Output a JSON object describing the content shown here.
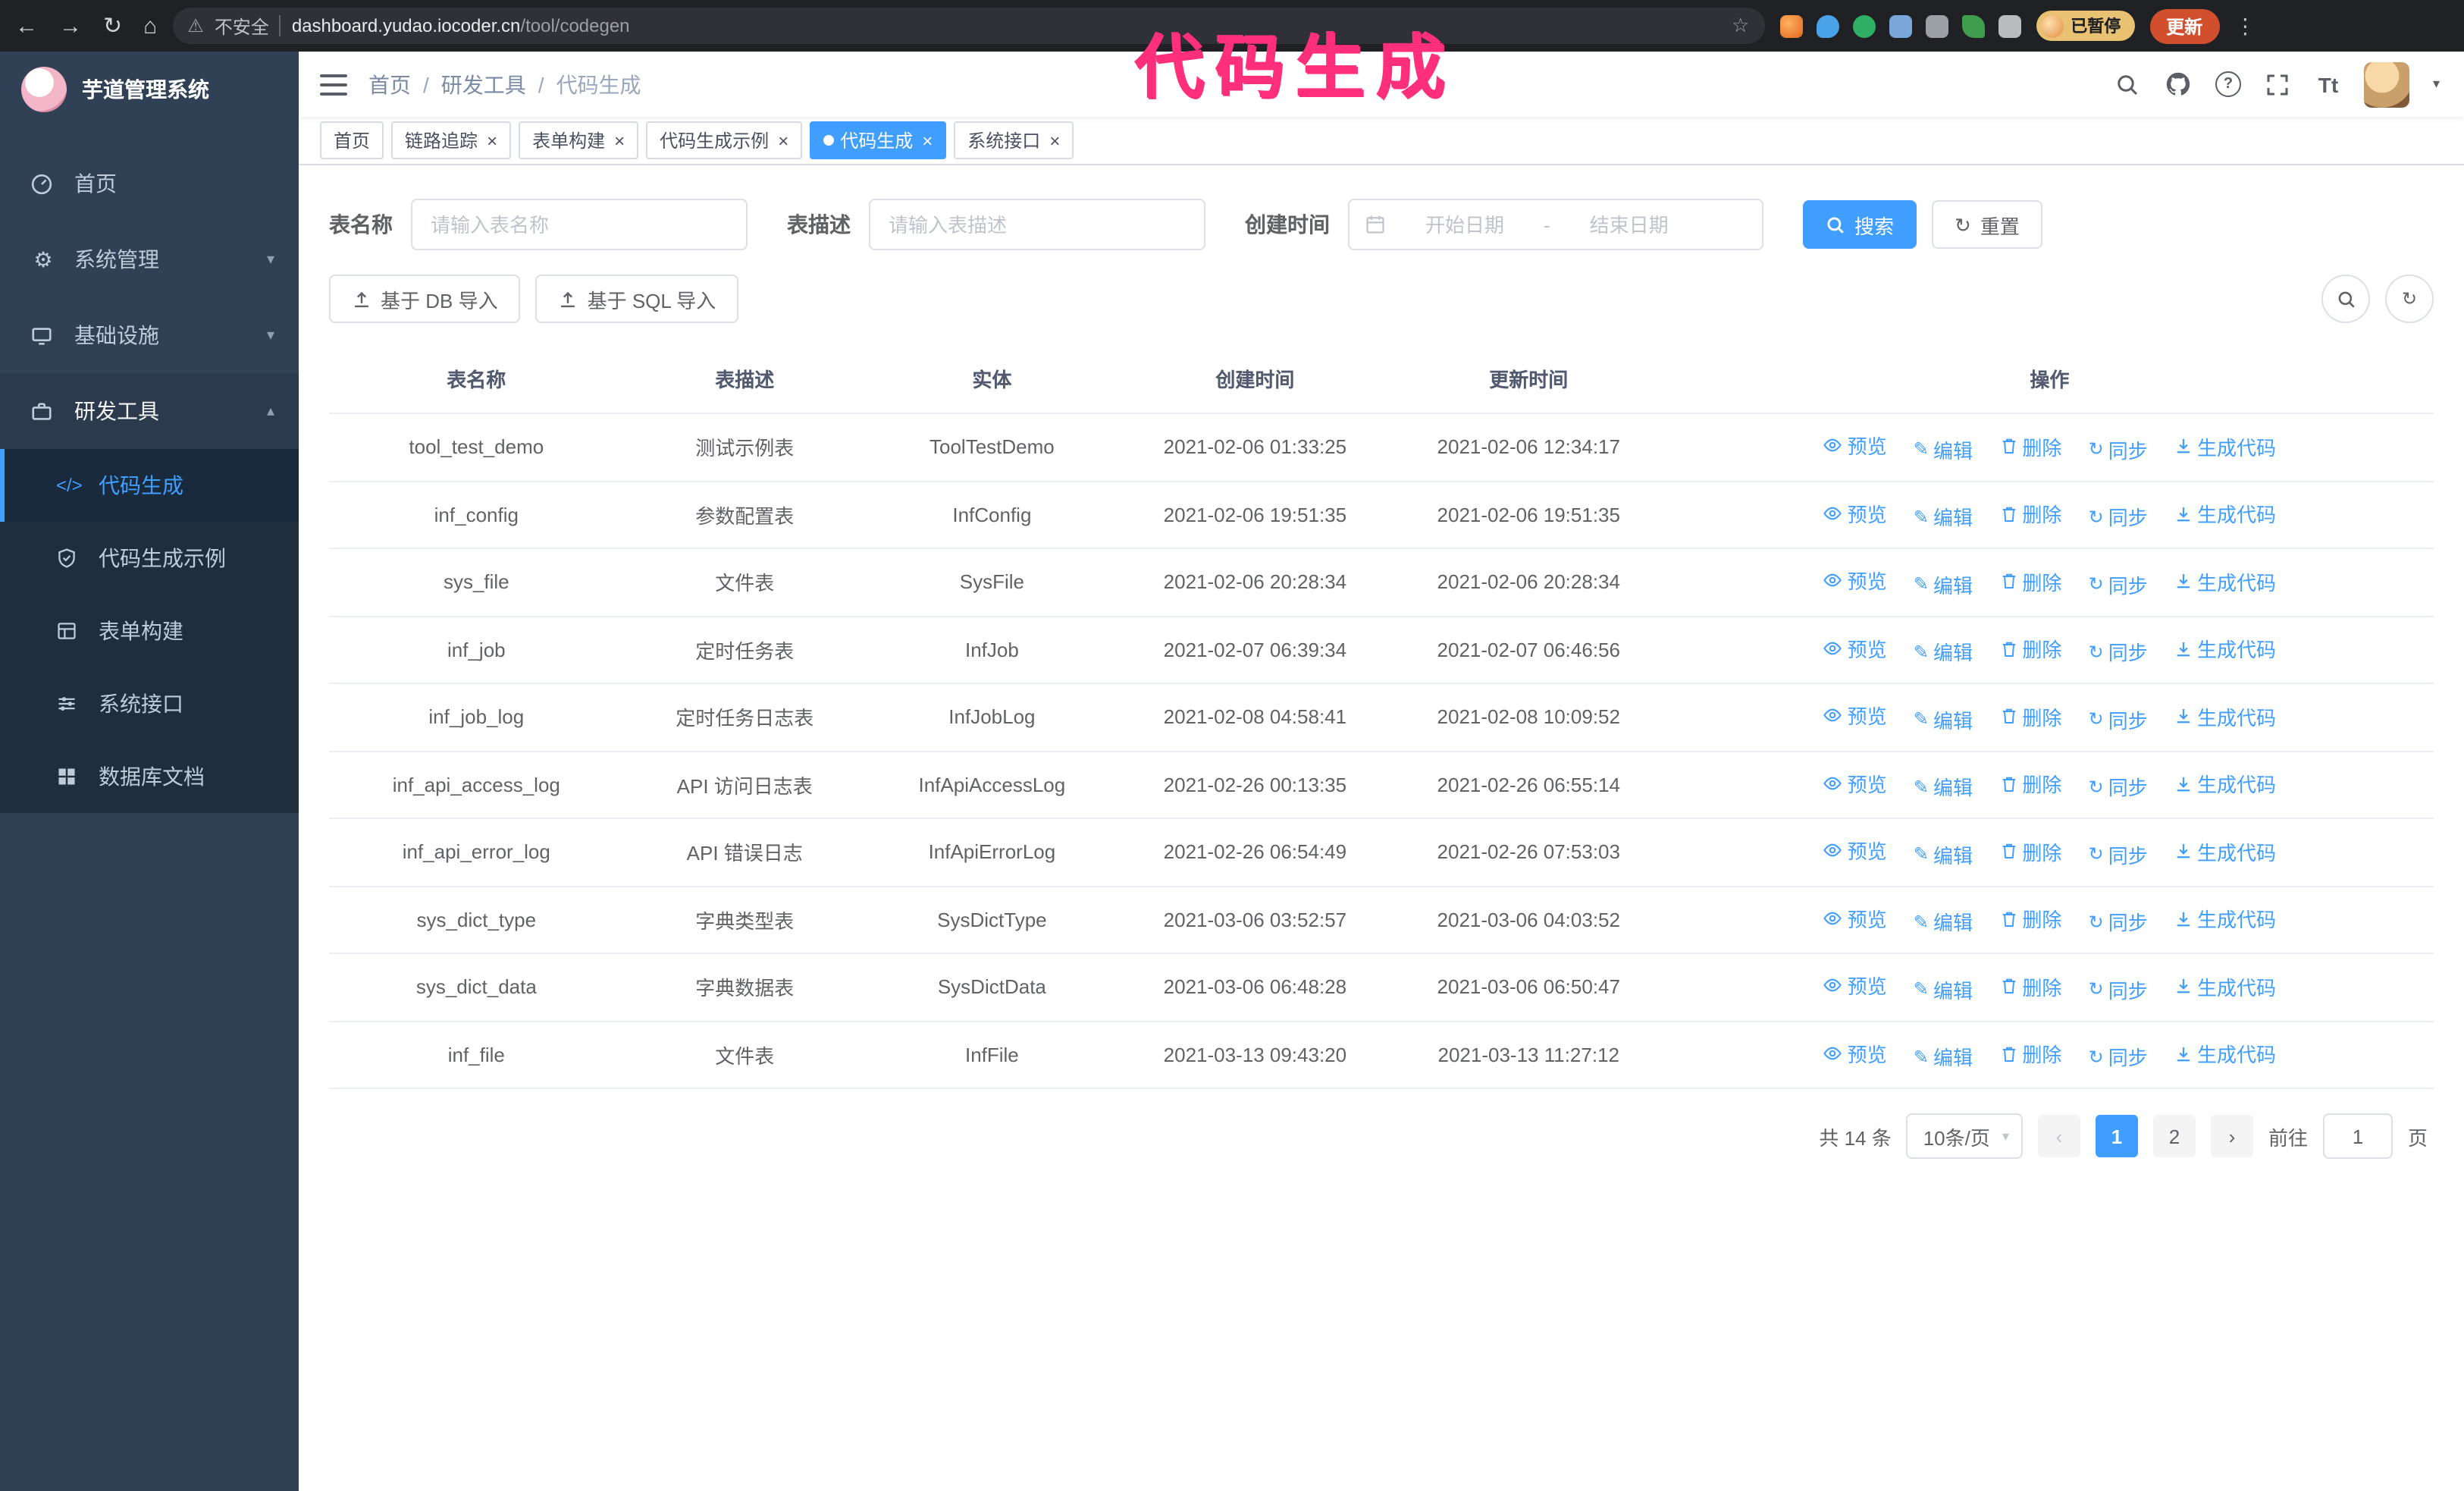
{
  "annotation": {
    "text": "代码生成",
    "color": "#ff2f7b"
  },
  "icons": {
    "back": "←",
    "forward": "→",
    "reload": "↻",
    "home": "⌂",
    "warning": "⚠",
    "star": "☆",
    "dots": "⋮",
    "close": "×",
    "chevron_down": "▾",
    "chevron_up": "▴",
    "caret_down": "▾",
    "question": "?",
    "font_size": "Tt",
    "gear": "⚙",
    "code": "</>",
    "edit": "✎",
    "sync": "↻",
    "refresh": "↻",
    "prev": "‹",
    "next": "›",
    "breadcrumb_separator": "/"
  },
  "browser": {
    "security_text": "不安全",
    "url_host": "dashboard.yudao.iocoder.cn",
    "url_path": "/tool/codegen",
    "extensions": [
      "fox-icon",
      "drop-icon",
      "v-icon",
      "people-icon",
      "translate-icon",
      "leaf-icon",
      "puzzle-icon"
    ],
    "profile_badge": "已暂停",
    "update_button": "更新"
  },
  "sidebar": {
    "logo_title": "芋道管理系统",
    "items": [
      {
        "icon": "dashboard-icon",
        "label": "首页"
      },
      {
        "icon": "gear-icon",
        "label": "系统管理",
        "chevron": "▾"
      },
      {
        "icon": "infra-icon",
        "label": "基础设施",
        "chevron": "▾"
      },
      {
        "icon": "tools-icon",
        "label": "研发工具",
        "chevron": "▴"
      }
    ],
    "submenu": [
      {
        "icon": "code-icon",
        "label": "代码生成",
        "active": true
      },
      {
        "icon": "example-icon",
        "label": "代码生成示例"
      },
      {
        "icon": "form-icon",
        "label": "表单构建"
      },
      {
        "icon": "api-icon",
        "label": "系统接口"
      },
      {
        "icon": "dbdoc-icon",
        "label": "数据库文档"
      }
    ]
  },
  "header": {
    "breadcrumb": [
      "首页",
      "研发工具",
      "代码生成"
    ]
  },
  "tabs": [
    {
      "label": "首页",
      "closable": false,
      "active": false
    },
    {
      "label": "链路追踪",
      "closable": true,
      "active": false
    },
    {
      "label": "表单构建",
      "closable": true,
      "active": false
    },
    {
      "label": "代码生成示例",
      "closable": true,
      "active": false
    },
    {
      "label": "代码生成",
      "closable": true,
      "active": true
    },
    {
      "label": "系统接口",
      "closable": true,
      "active": false
    }
  ],
  "filters": {
    "table_name_label": "表名称",
    "table_name_placeholder": "请输入表名称",
    "table_desc_label": "表描述",
    "table_desc_placeholder": "请输入表描述",
    "create_time_label": "创建时间",
    "start_date_placeholder": "开始日期",
    "date_separator": "-",
    "end_date_placeholder": "结束日期",
    "search_button": "搜索",
    "reset_button": "重置"
  },
  "toolbar": {
    "import_db": "基于 DB 导入",
    "import_sql": "基于 SQL 导入"
  },
  "table": {
    "columns": [
      "表名称",
      "表描述",
      "实体",
      "创建时间",
      "更新时间",
      "操作"
    ],
    "actions": [
      "预览",
      "编辑",
      "删除",
      "同步",
      "生成代码"
    ],
    "rows": [
      {
        "name": "tool_test_demo",
        "desc": "测试示例表",
        "entity": "ToolTestDemo",
        "created": "2021-02-06 01:33:25",
        "updated": "2021-02-06 12:34:17"
      },
      {
        "name": "inf_config",
        "desc": "参数配置表",
        "entity": "InfConfig",
        "created": "2021-02-06 19:51:35",
        "updated": "2021-02-06 19:51:35"
      },
      {
        "name": "sys_file",
        "desc": "文件表",
        "entity": "SysFile",
        "created": "2021-02-06 20:28:34",
        "updated": "2021-02-06 20:28:34"
      },
      {
        "name": "inf_job",
        "desc": "定时任务表",
        "entity": "InfJob",
        "created": "2021-02-07 06:39:34",
        "updated": "2021-02-07 06:46:56"
      },
      {
        "name": "inf_job_log",
        "desc": "定时任务日志表",
        "entity": "InfJobLog",
        "created": "2021-02-08 04:58:41",
        "updated": "2021-02-08 10:09:52"
      },
      {
        "name": "inf_api_access_log",
        "desc": "API 访问日志表",
        "entity": "InfApiAccessLog",
        "created": "2021-02-26 00:13:35",
        "updated": "2021-02-26 06:55:14"
      },
      {
        "name": "inf_api_error_log",
        "desc": "API 错误日志",
        "entity": "InfApiErrorLog",
        "created": "2021-02-26 06:54:49",
        "updated": "2021-02-26 07:53:03"
      },
      {
        "name": "sys_dict_type",
        "desc": "字典类型表",
        "entity": "SysDictType",
        "created": "2021-03-06 03:52:57",
        "updated": "2021-03-06 04:03:52"
      },
      {
        "name": "sys_dict_data",
        "desc": "字典数据表",
        "entity": "SysDictData",
        "created": "2021-03-06 06:48:28",
        "updated": "2021-03-06 06:50:47"
      },
      {
        "name": "inf_file",
        "desc": "文件表",
        "entity": "InfFile",
        "created": "2021-03-13 09:43:20",
        "updated": "2021-03-13 11:27:12"
      }
    ]
  },
  "pagination": {
    "total": "共 14 条",
    "page_size": "10条/页",
    "pages": [
      "1",
      "2"
    ],
    "current": "1",
    "goto_label": "前往",
    "goto_value": "1",
    "goto_suffix": "页"
  },
  "colors": {
    "primary": "#409eff",
    "sidebar_bg": "#304156",
    "submenu_bg": "#1f2d3d",
    "annotation": "#ff2f7b"
  }
}
